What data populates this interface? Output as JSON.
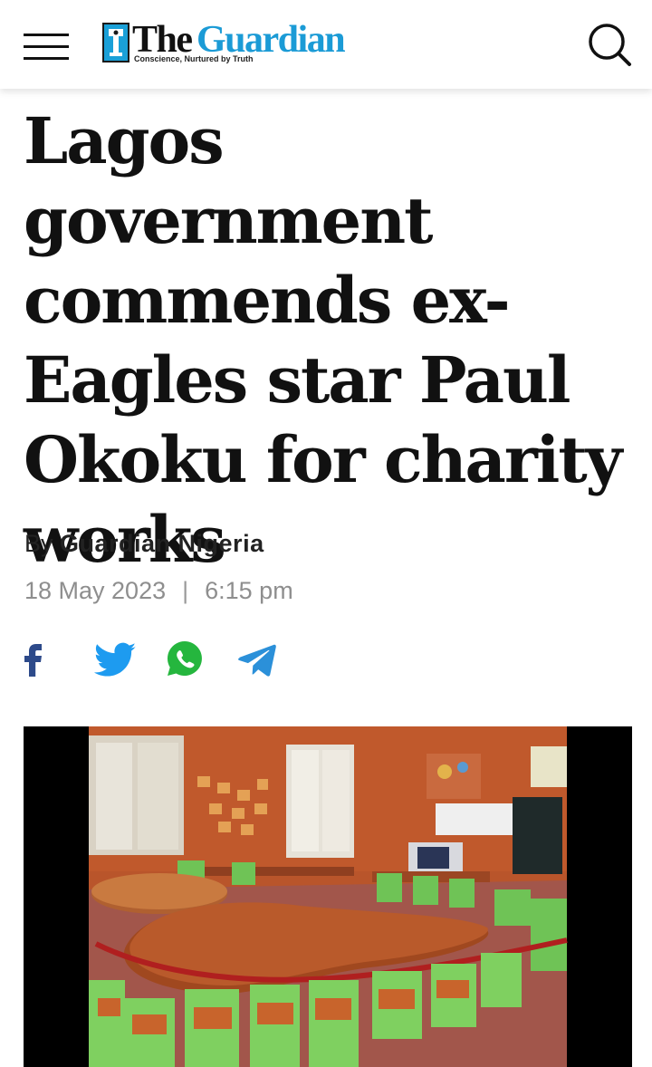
{
  "header": {
    "logo_the": "The",
    "logo_guardian": "Guardian",
    "logo_tagline": "Conscience, Nurtured by Truth",
    "menu_icon": "hamburger-menu-icon",
    "search_icon": "search-icon"
  },
  "article": {
    "headline": "Lagos government commends ex-Eagles star Paul Okoku for charity works",
    "byline_prefix": "By",
    "author": "Guardian Nigeria",
    "date": "18 May 2023",
    "separator": "|",
    "time": "6:15 pm"
  },
  "share": [
    {
      "name": "facebook-icon",
      "color": "#2d4a8a"
    },
    {
      "name": "twitter-icon",
      "color": "#1d9bf0"
    },
    {
      "name": "whatsapp-icon",
      "color": "#25b63e"
    },
    {
      "name": "telegram-icon",
      "color": "#2b90d9"
    }
  ],
  "colors": {
    "brand_blue": "#1b9bd6",
    "text": "#111111",
    "meta_gray": "#8e8e8e"
  }
}
